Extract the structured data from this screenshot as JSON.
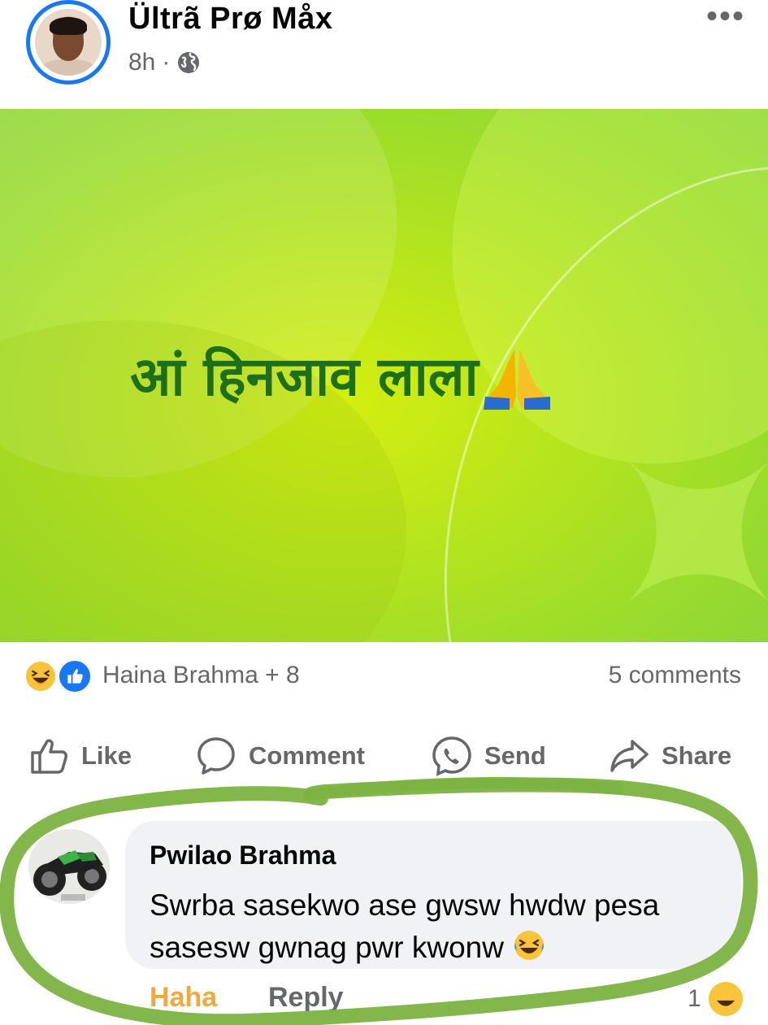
{
  "post": {
    "author": "Ültrã Prø Måx",
    "time": "8h",
    "separator": "·",
    "banner_text": "आं हिनजाव लाला"
  },
  "reactions": {
    "summary": "Haina Brahma + 8",
    "comments": "5 comments"
  },
  "actions": {
    "like": "Like",
    "comment": "Comment",
    "send": "Send",
    "share": "Share"
  },
  "comment": {
    "author": "Pwilao Brahma",
    "text": "Swrba sasekwo ase gwsw hwdw pesa sasesw gwnag pwr kwonw",
    "haha": "Haha",
    "reply": "Reply",
    "count": "1"
  },
  "colors": {
    "brand_blue": "#1877f2",
    "haha_orange": "#f2a93b",
    "banner_text": "#1e6f19",
    "highlight_green": "#7cb342",
    "muted_text": "#65676b"
  },
  "icons": [
    "globe-icon",
    "more-icon",
    "pray-icon",
    "haha-reaction-icon",
    "like-reaction-icon",
    "like-icon",
    "comment-icon",
    "messenger-icon",
    "share-icon",
    "laugh-emoji-icon"
  ]
}
